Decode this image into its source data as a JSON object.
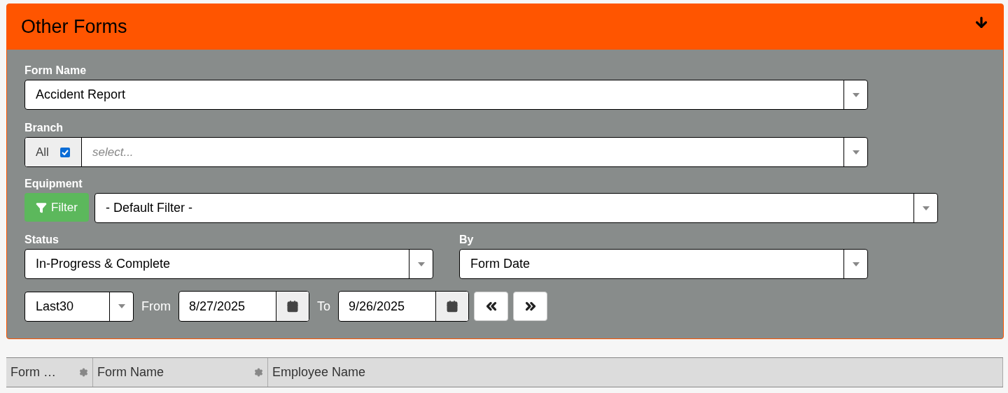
{
  "panel": {
    "title": "Other Forms"
  },
  "form_name": {
    "label": "Form Name",
    "value": "Accident Report"
  },
  "branch": {
    "label": "Branch",
    "all_label": "All",
    "all_checked": true,
    "placeholder": "select..."
  },
  "equipment": {
    "label": "Equipment",
    "filter_button": "Filter",
    "value": "- Default Filter -"
  },
  "status": {
    "label": "Status",
    "value": "In-Progress & Complete"
  },
  "by": {
    "label": "By",
    "value": "Form Date"
  },
  "range": {
    "value": "Last30",
    "from_label": "From",
    "from": "8/27/2025",
    "to_label": "To",
    "to": "9/26/2025"
  },
  "table": {
    "columns": [
      {
        "label": "Form …",
        "gear": true
      },
      {
        "label": "Form Name",
        "gear": true
      },
      {
        "label": "Employee Name",
        "gear": false
      }
    ]
  }
}
